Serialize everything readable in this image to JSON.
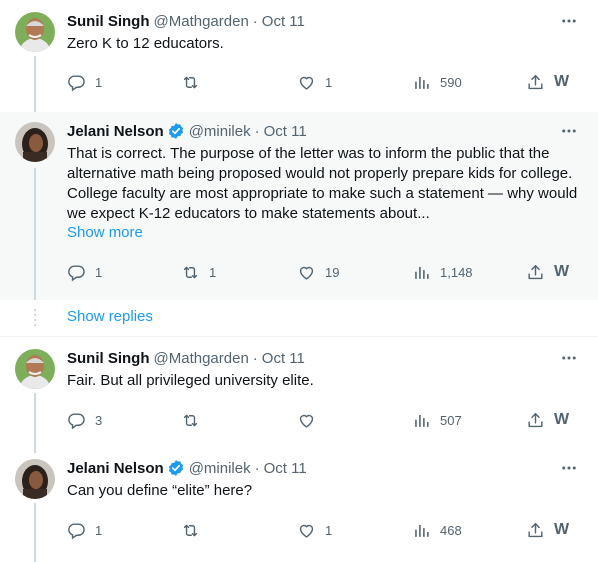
{
  "colors": {
    "accent": "#1d9bf0",
    "muted": "#536471",
    "text": "#0f1419",
    "highlight_bg": "#f7f9f9"
  },
  "tweets": [
    {
      "name": "Sunil Singh",
      "handle": "@Mathgarden",
      "dot": "·",
      "time": "Oct 11",
      "verified": false,
      "text": "Zero K to 12 educators.",
      "reply_count": "1",
      "retweet_count": "",
      "like_count": "1",
      "view_count": "590"
    },
    {
      "name": "Jelani Nelson",
      "handle": "@minilek",
      "dot": "·",
      "time": "Oct 11",
      "verified": true,
      "text": "That is correct. The purpose of the letter was to inform the public that the alternative math being proposed would not properly prepare kids for college. College faculty are most appropriate to make such a statement — why would we expect K-12 educators to make statements about...",
      "show_more": "Show more",
      "reply_count": "1",
      "retweet_count": "1",
      "like_count": "19",
      "view_count": "1,148"
    },
    {
      "name": "Sunil Singh",
      "handle": "@Mathgarden",
      "dot": "·",
      "time": "Oct 11",
      "verified": false,
      "text": "Fair. But all privileged university elite.",
      "reply_count": "3",
      "retweet_count": "",
      "like_count": "",
      "view_count": "507"
    },
    {
      "name": "Jelani Nelson",
      "handle": "@minilek",
      "dot": "·",
      "time": "Oct 11",
      "verified": true,
      "text": "Can you define “elite” here?",
      "reply_count": "1",
      "retweet_count": "",
      "like_count": "1",
      "view_count": "468"
    }
  ],
  "show_replies": "Show replies",
  "more_icon": "•••",
  "w_icon": "W",
  "icons": [
    "reply-icon",
    "retweet-icon",
    "like-icon",
    "views-icon",
    "share-icon",
    "more-icon",
    "verified-icon"
  ]
}
